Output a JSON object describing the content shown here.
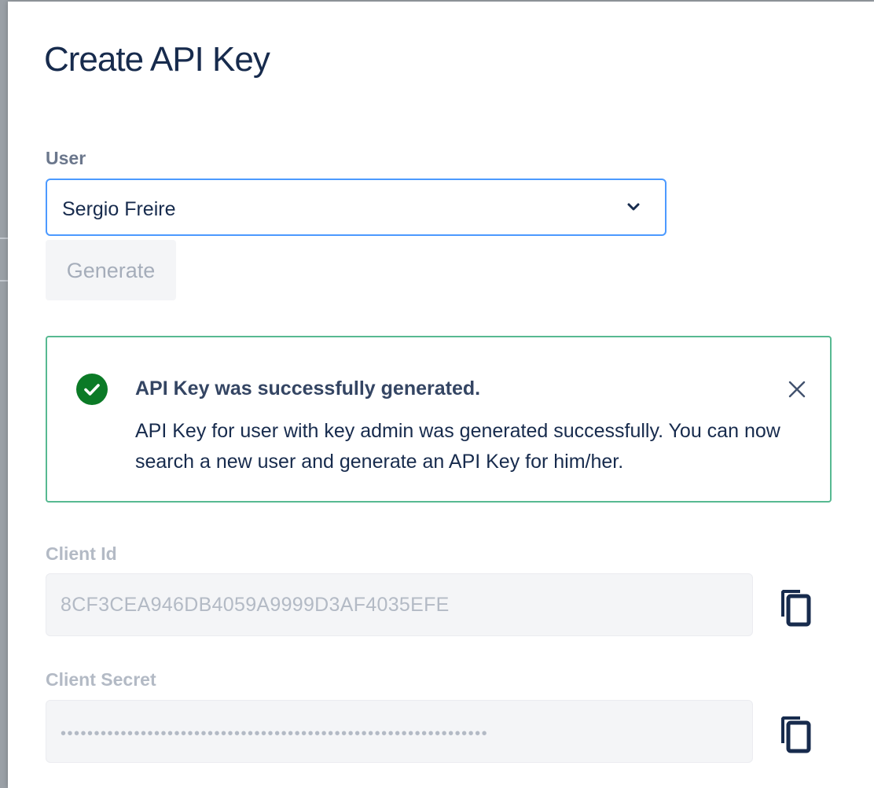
{
  "modal": {
    "title": "Create API Key"
  },
  "user_field": {
    "label": "User",
    "selected_value": "Sergio Freire",
    "chevron_icon": "chevron-down-icon"
  },
  "generate_button": {
    "label": "Generate",
    "disabled": true
  },
  "alert": {
    "type": "success",
    "icon": "check-circle-icon",
    "title": "API Key was successfully generated.",
    "message": "API Key for user with key admin was generated successfully. You can now search a new user and generate an API Key for him/her.",
    "close_icon": "close-icon"
  },
  "client_id": {
    "label": "Client Id",
    "value": "8CF3CEA946DB4059A9999D3AF4035EFE",
    "copy_icon": "copy-icon"
  },
  "client_secret": {
    "label": "Client Secret",
    "masked_value": "••••••••••••••••••••••••••••••••••••••••••••••••••••••••••••••••",
    "copy_icon": "copy-icon"
  },
  "colors": {
    "title": "#172b4d",
    "select_border_focus": "#4c9aff",
    "alert_border": "#57b991",
    "success_icon": "#00875a",
    "disabled_text": "#b3bac5",
    "field_background": "#f4f5f7"
  }
}
